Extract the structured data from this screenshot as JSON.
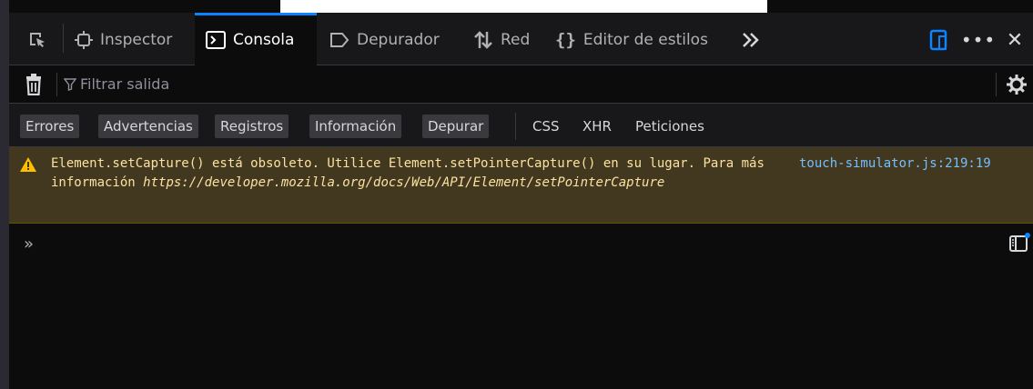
{
  "tabs": {
    "pick_icon": "element-picker-icon",
    "inspector": {
      "label": "Inspector",
      "icon": "inspector-icon"
    },
    "console": {
      "label": "Consola",
      "icon": "console-icon"
    },
    "debugger": {
      "label": "Depurador",
      "icon": "debugger-icon"
    },
    "network": {
      "label": "Red",
      "icon": "network-arrows-icon"
    },
    "style_editor": {
      "label": "Editor de estilos",
      "icon": "braces-icon"
    },
    "overflow": "chevron-double-right-icon"
  },
  "toolbar_right": {
    "responsive": "responsive-design-icon",
    "more": "•••",
    "close": "✕"
  },
  "filter": {
    "placeholder": "Filtrar salida"
  },
  "levels": [
    "Errores",
    "Advertencias",
    "Registros",
    "Información",
    "Depurar"
  ],
  "requests": [
    "CSS",
    "XHR",
    "Peticiones"
  ],
  "message": {
    "text_part1": "Element.setCapture() está obsoleto. Utilice Element.setPointerCapture() en su lugar. Para más información ",
    "link": "https://developer.mozilla.org/docs/Web/API/Element/setPointerCapture",
    "source": "touch-simulator.js:219:19"
  },
  "prompt_symbol": "»",
  "colors": {
    "accent": "#0a84ff",
    "warning_bg": "#42381f",
    "warning_text": "#fce2a1",
    "link": "#75bfff"
  }
}
